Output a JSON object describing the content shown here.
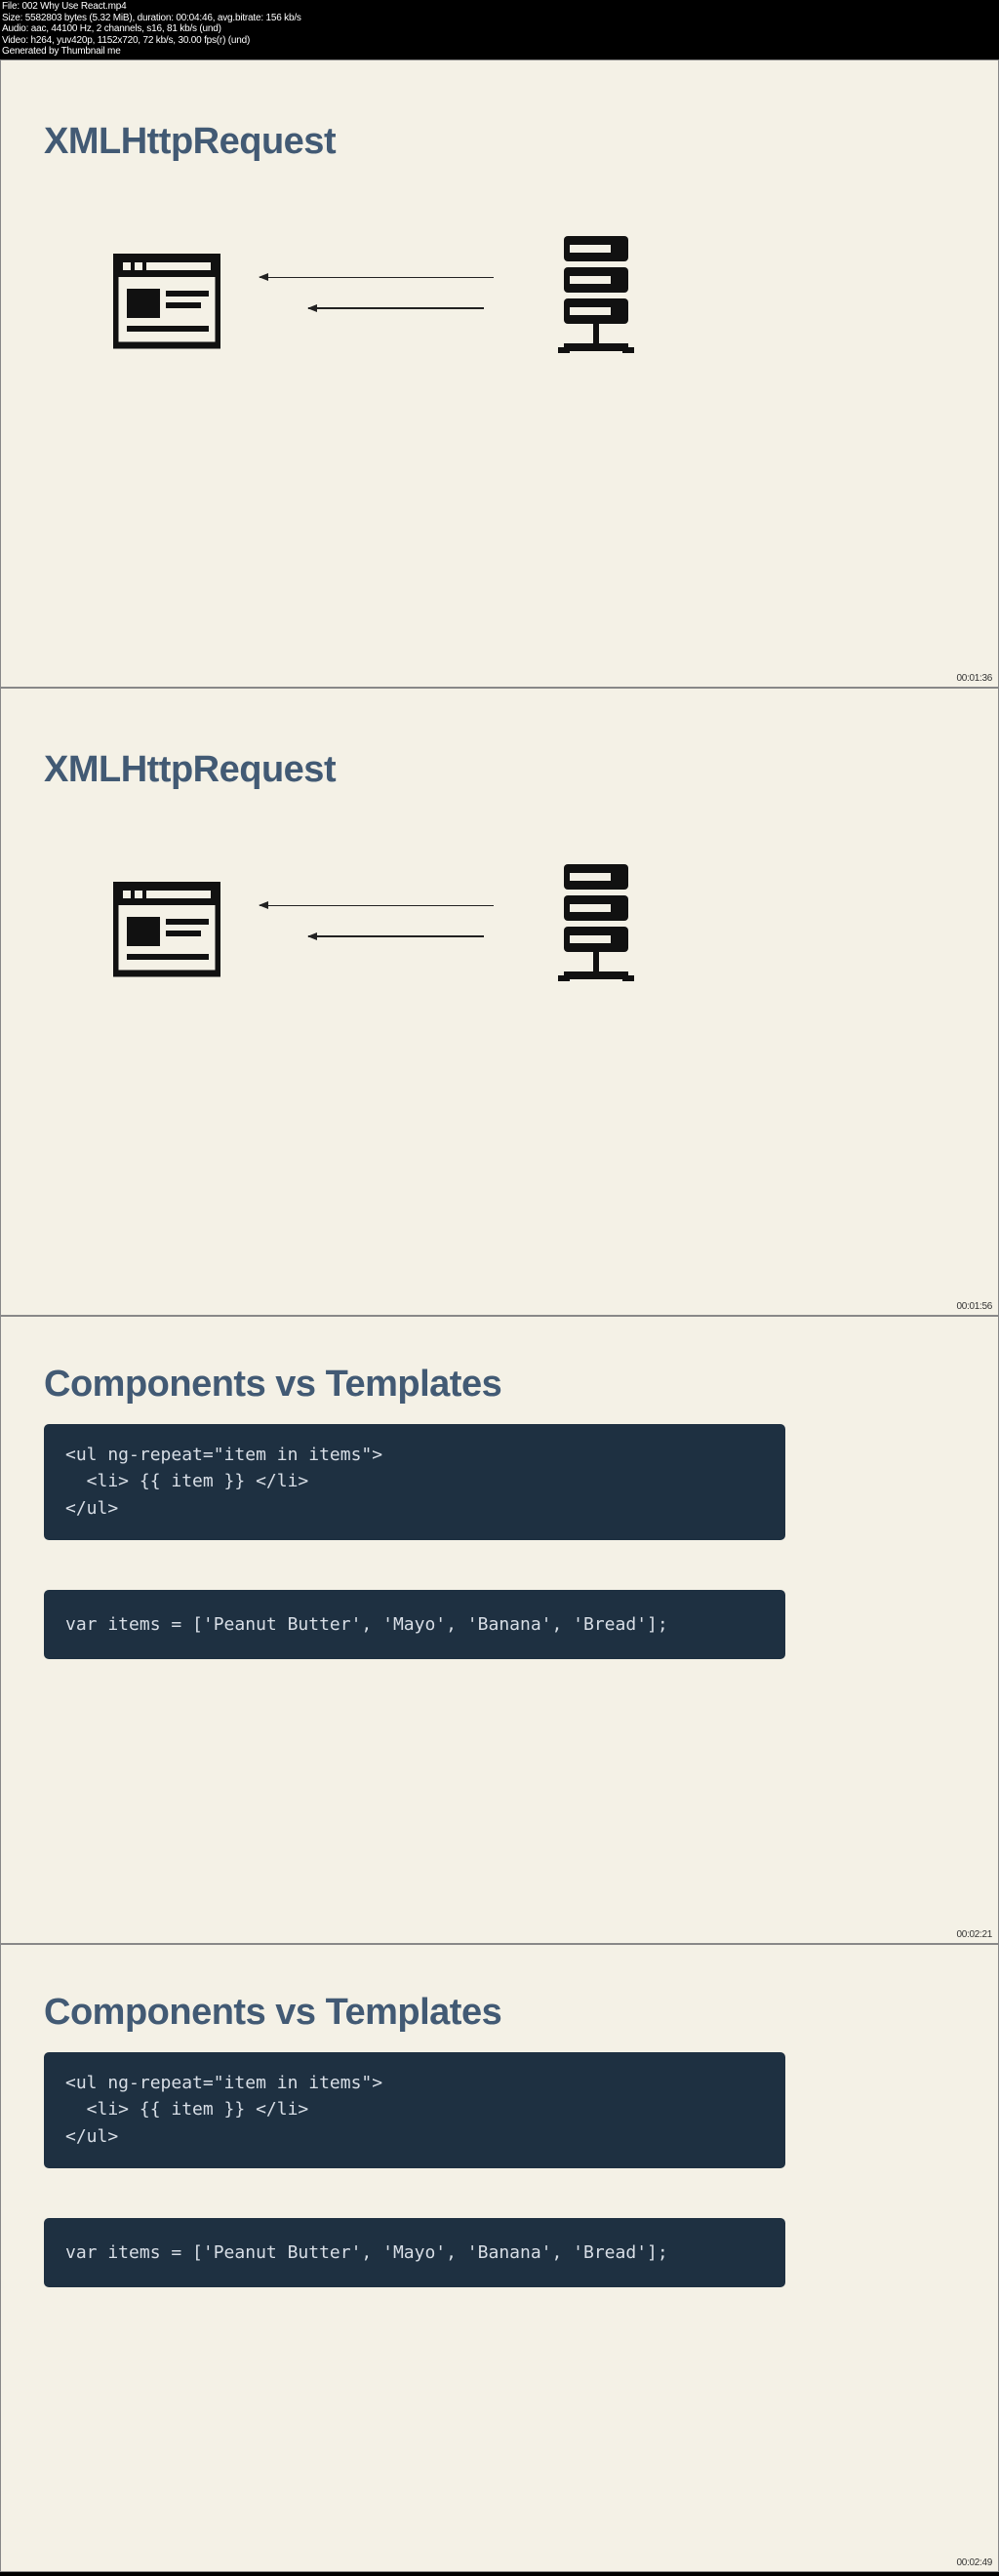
{
  "header": {
    "line1": "File: 002 Why Use React.mp4",
    "line2": "Size: 5582803 bytes (5.32 MiB), duration: 00:04:46, avg.bitrate: 156 kb/s",
    "line3": "Audio: aac, 44100 Hz, 2 channels, s16, 81 kb/s (und)",
    "line4": "Video: h264, yuv420p, 1152x720, 72 kb/s, 30.00 fps(r) (und)",
    "line5": "Generated by Thumbnail me"
  },
  "slides": {
    "s1": {
      "title": "XMLHttpRequest",
      "timestamp": "00:01:36"
    },
    "s2": {
      "title": "XMLHttpRequest",
      "timestamp": "00:01:56"
    },
    "s3": {
      "title": "Components vs Templates",
      "code1": "<ul ng-repeat=\"item in items\">\n  <li> {{ item }} </li>\n</ul>",
      "code2": "var items = ['Peanut Butter', 'Mayo', 'Banana', 'Bread'];",
      "timestamp": "00:02:21"
    },
    "s4": {
      "title": "Components vs Templates",
      "code1": "<ul ng-repeat=\"item in items\">\n  <li> {{ item }} </li>\n</ul>",
      "code2": "var items = ['Peanut Butter', 'Mayo', 'Banana', 'Bread'];",
      "timestamp": "00:02:49"
    }
  }
}
